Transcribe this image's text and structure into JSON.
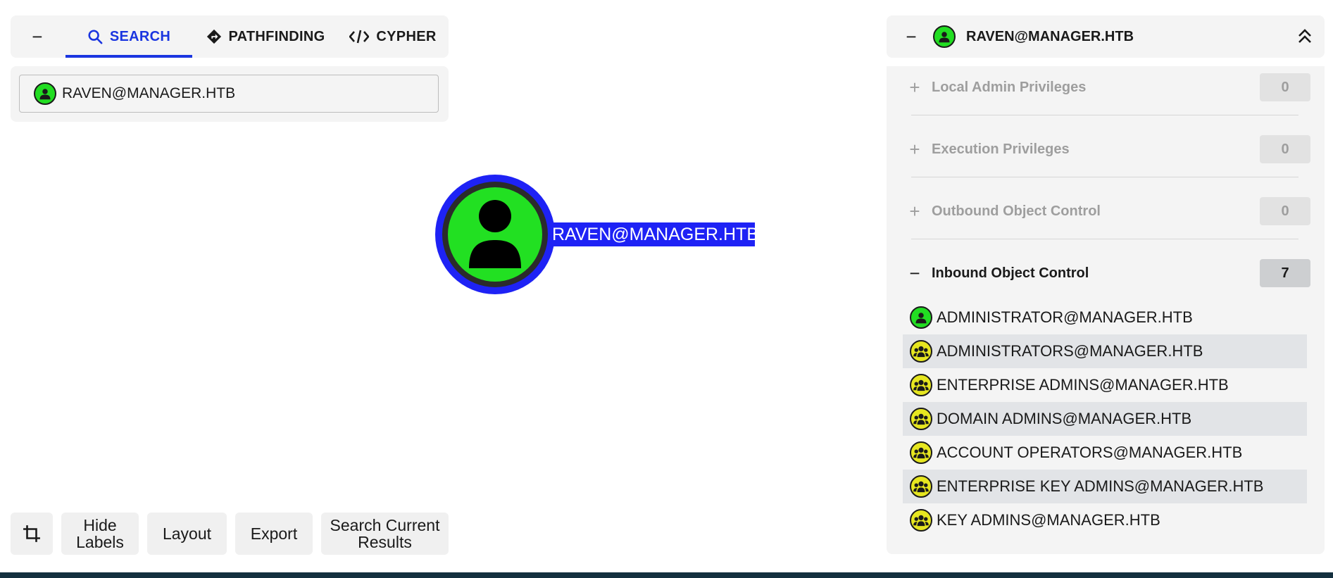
{
  "tabs": {
    "collapse_label": "−",
    "search": "SEARCH",
    "pathfinding": "PATHFINDING",
    "cypher": "CYPHER"
  },
  "search": {
    "value": "RAVEN@MANAGER.HTB",
    "icon": "user-icon"
  },
  "graph": {
    "node_label": "RAVEN@MANAGER.HTB",
    "node_icon": "user-icon",
    "node_color": "#22e022",
    "highlight_color": "#1e22f5"
  },
  "toolbar": {
    "crop_icon": "crop-icon",
    "hide_labels": "Hide Labels",
    "layout": "Layout",
    "export": "Export",
    "search_current_results": "Search Current Results"
  },
  "details": {
    "collapse_label": "−",
    "title": "RAVEN@MANAGER.HTB",
    "sections": [
      {
        "sign": "+",
        "label": "Local Admin Privileges",
        "count": "0"
      },
      {
        "sign": "+",
        "label": "Execution Privileges",
        "count": "0"
      },
      {
        "sign": "+",
        "label": "Outbound Object Control",
        "count": "0"
      },
      {
        "sign": "−",
        "label": "Inbound Object Control",
        "count": "7"
      }
    ],
    "inbound": [
      {
        "name": "ADMINISTRATOR@MANAGER.HTB",
        "type": "user"
      },
      {
        "name": "ADMINISTRATORS@MANAGER.HTB",
        "type": "group"
      },
      {
        "name": "ENTERPRISE ADMINS@MANAGER.HTB",
        "type": "group"
      },
      {
        "name": "DOMAIN ADMINS@MANAGER.HTB",
        "type": "group"
      },
      {
        "name": "ACCOUNT OPERATORS@MANAGER.HTB",
        "type": "group"
      },
      {
        "name": "ENTERPRISE KEY ADMINS@MANAGER.HTB",
        "type": "group"
      },
      {
        "name": "KEY ADMINS@MANAGER.HTB",
        "type": "group"
      }
    ]
  },
  "colors": {
    "accent": "#1a35e0",
    "user": "#22dd22",
    "group": "#e6e620"
  }
}
